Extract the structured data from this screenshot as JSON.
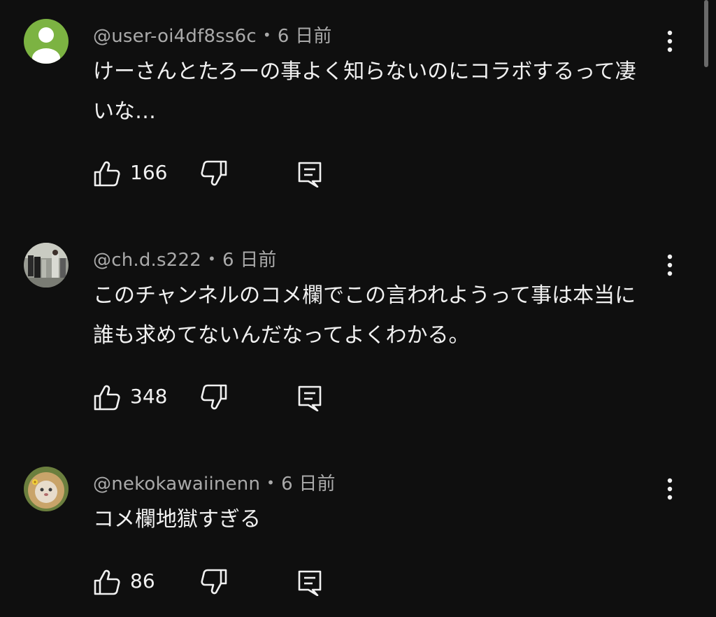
{
  "comments": [
    {
      "author": "@user-oi4df8ss6c",
      "time": "6 日前",
      "text": "けーさんとたろーの事よく知らないのにコラボするって凄いな…",
      "likes": "166",
      "avatar": "default-person-avatar"
    },
    {
      "author": "@ch.d.s222",
      "time": "6 日前",
      "text": "このチャンネルのコメ欄でこの言われようって事は本当に誰も求めてないんだなってよくわかる。",
      "likes": "348",
      "avatar": "photo-avatar"
    },
    {
      "author": "@nekokawaiinenn",
      "time": "6 日前",
      "text": "コメ欄地獄すぎる",
      "likes": "86",
      "avatar": "cat-lion-avatar"
    }
  ],
  "separator": "•",
  "icons": {
    "like": "thumbs-up-icon",
    "dislike": "thumbs-down-icon",
    "reply": "reply-comment-icon",
    "more": "more-vertical-icon"
  },
  "colors": {
    "background": "#0f0f0f",
    "text": "#f1f1f1",
    "meta": "#aaaaaa",
    "default_avatar": "#7cb342"
  }
}
